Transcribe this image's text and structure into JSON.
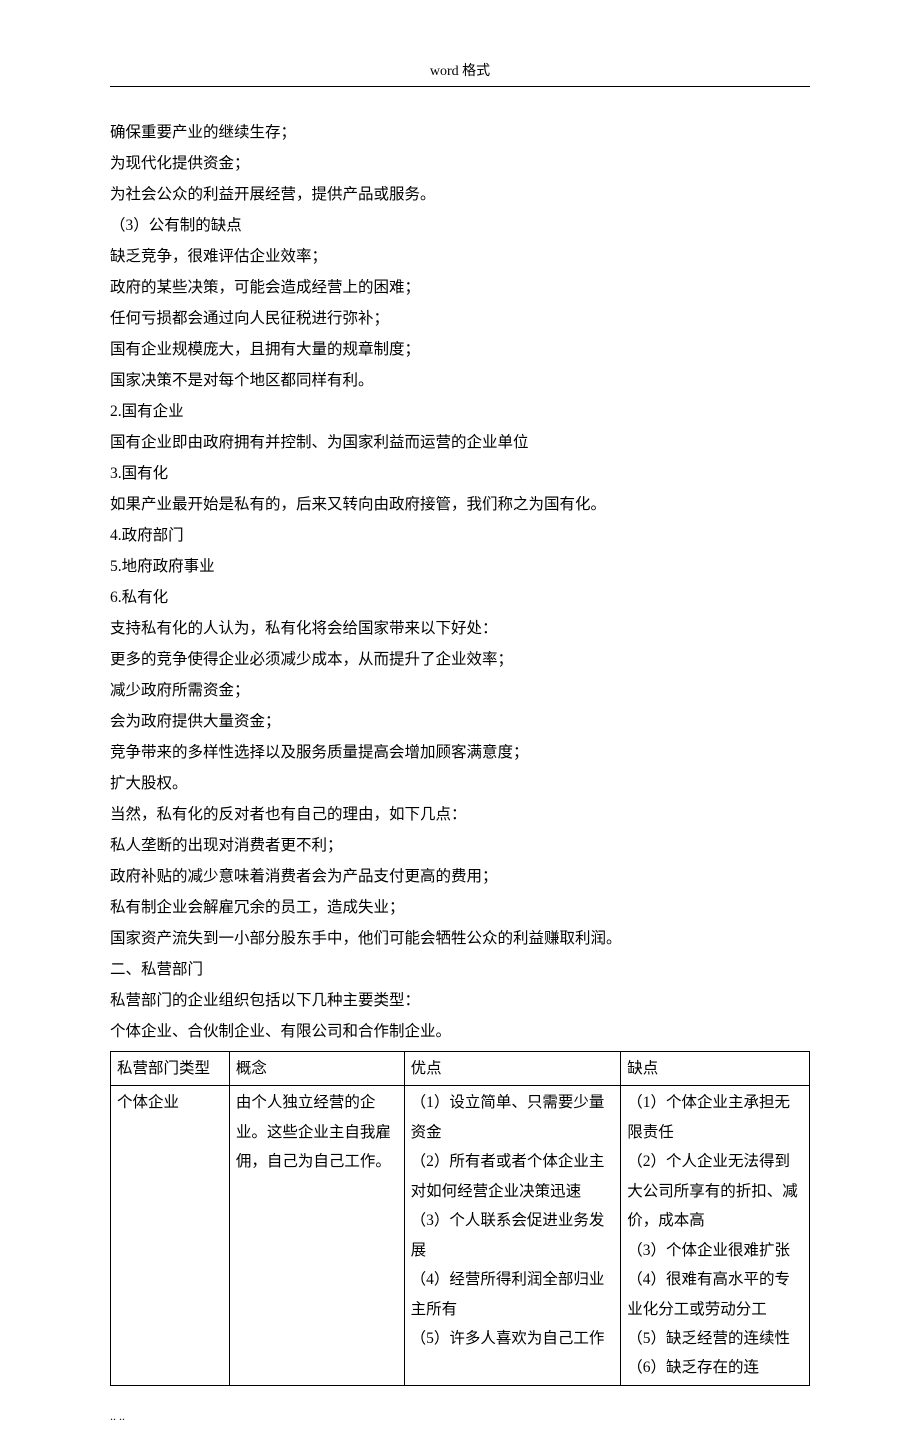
{
  "header": "word 格式",
  "footer": "..  ..",
  "lines": [
    "确保重要产业的继续生存；",
    "为现代化提供资金；",
    "为社会公众的利益开展经营，提供产品或服务。",
    "（3）公有制的缺点",
    "缺乏竞争，很难评估企业效率；",
    "政府的某些决策，可能会造成经营上的困难；",
    "任何亏损都会通过向人民征税进行弥补；",
    "国有企业规模庞大，且拥有大量的规章制度；",
    "国家决策不是对每个地区都同样有利。",
    "2.国有企业",
    "国有企业即由政府拥有并控制、为国家利益而运营的企业单位",
    "3.国有化",
    "如果产业最开始是私有的，后来又转向由政府接管，我们称之为国有化。",
    "4.政府部门",
    "5.地府政府事业",
    "6.私有化",
    "支持私有化的人认为，私有化将会给国家带来以下好处：",
    "更多的竞争使得企业必须减少成本，从而提升了企业效率；",
    "减少政府所需资金；",
    "会为政府提供大量资金；",
    "竞争带来的多样性选择以及服务质量提高会增加顾客满意度；",
    "扩大股权。",
    "当然，私有化的反对者也有自己的理由，如下几点：",
    "私人垄断的出现对消费者更不利；",
    "政府补贴的减少意味着消费者会为产品支付更高的费用；",
    "私有制企业会解雇冗余的员工，造成失业；",
    "国家资产流失到一小部分股东手中，他们可能会牺牲公众的利益赚取利润。",
    "二、私营部门",
    "私营部门的企业组织包括以下几种主要类型：",
    "个体企业、合伙制企业、有限公司和合作制企业。"
  ],
  "table": {
    "head": [
      "私营部门类型",
      "概念",
      "优点",
      "缺点"
    ],
    "row": {
      "c1": "个体企业",
      "c2": "由个人独立经营的企业。这些企业主自我雇佣，自己为自己工作。",
      "c3": "（1）设立简单、只需要少量资金\n（2）所有者或者个体企业主对如何经营企业决策迅速\n（3）个人联系会促进业务发展\n（4）经营所得利润全部归业主所有\n（5）许多人喜欢为自己工作",
      "c4": "（1）个体企业主承担无限责任\n（2）个人企业无法得到大公司所享有的折扣、减价，成本高\n（3）个体企业很难扩张\n（4）很难有高水平的专业化分工或劳动分工\n（5）缺乏经营的连续性\n（6）缺乏存在的连"
    }
  }
}
